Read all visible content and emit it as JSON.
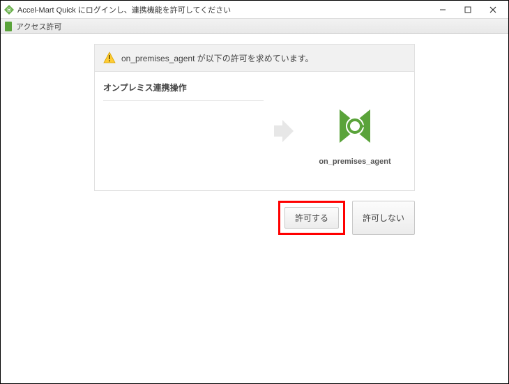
{
  "window": {
    "title": "Accel-Mart Quick にログインし、連携機能を許可してください"
  },
  "subbar": {
    "label": "アクセス許可"
  },
  "dialog": {
    "request_text": "on_premises_agent が以下の許可を求めています。",
    "permission_item": "オンプレミス連携操作",
    "agent_name": "on_premises_agent"
  },
  "buttons": {
    "allow": "許可する",
    "deny": "許可しない"
  }
}
